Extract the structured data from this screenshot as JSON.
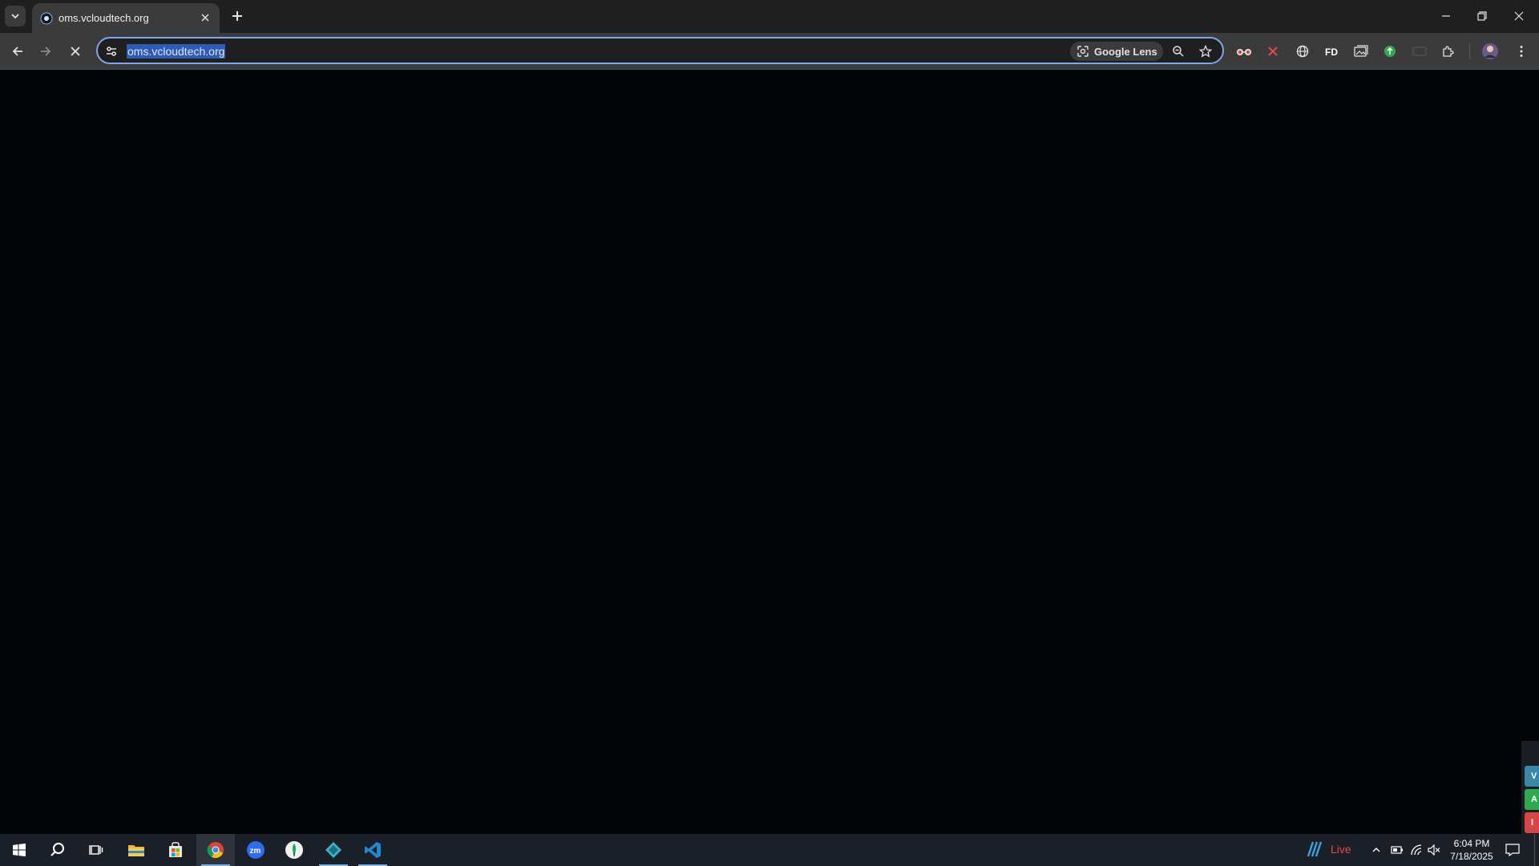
{
  "tab": {
    "title": "oms.vcloudtech.org"
  },
  "omnibox": {
    "url": "oms.vcloudtech.org",
    "lens_label": "Google Lens"
  },
  "extensions": [
    "glasses-extension",
    "x-extension",
    "globe-extension",
    "fd-extension",
    "gallery-extension",
    "green-extension",
    "card-extension",
    "puzzle-extension"
  ],
  "side_tabs": [
    "V",
    "A",
    "I"
  ],
  "taskbar": {
    "apps": [
      "start",
      "search",
      "task-view",
      "file-explorer",
      "store",
      "chrome",
      "zoom",
      "mongodb",
      "app-diamond",
      "vscode"
    ],
    "weather_label": "Live",
    "time": "6:04 PM",
    "date": "7/18/2025"
  },
  "colors": {
    "accent": "#7fa6e8",
    "url_highlight": "#2c5bb8",
    "live_red": "#e8474a"
  }
}
